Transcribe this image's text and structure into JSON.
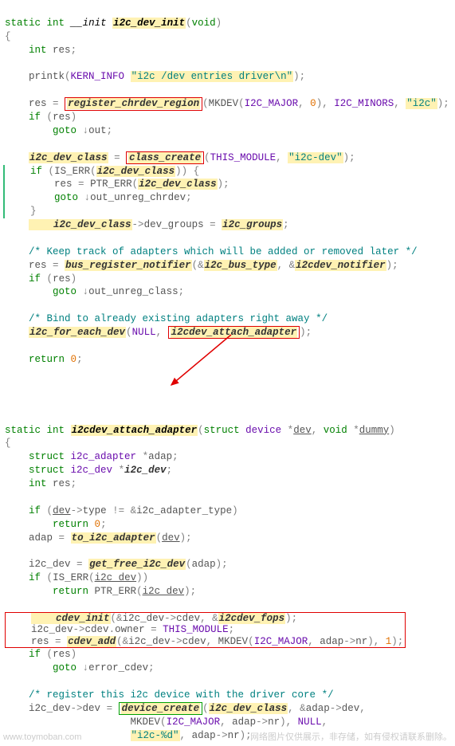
{
  "func1": {
    "sig_pre": "static int __init ",
    "name": "i2c_dev_init",
    "sig_post": "(void)",
    "l01": "    int res;",
    "l02a": "    printk(KERN_INFO ",
    "l02b": "\"i2c /dev entries driver\\n\"",
    "l02c": ");",
    "l03a": "    res = ",
    "l03b": "register_chrdev_region",
    "l03c": "(MKDEV(I2C_MAJOR, 0), I2C_MINORS, ",
    "l03d": "\"i2c\"",
    "l03e": ");",
    "l04": "    if (res)",
    "l05": "        goto ↓out;",
    "l06a": "    i2c_dev_class = ",
    "l06b": "class_create",
    "l06c": "(THIS_MODULE, ",
    "l06d": "\"i2c-dev\"",
    "l06e": ");",
    "l07a": "    if (IS_ERR(",
    "l07b": "i2c_dev_class",
    "l07c": ")) {",
    "l08a": "        res = PTR_ERR(",
    "l08b": "i2c_dev_class",
    "l08c": ");",
    "l09": "        goto ↓out_unreg_chrdev;",
    "l10": "    }",
    "l11a": "    i2c_dev_class",
    "l11b": "->dev_groups = ",
    "l11c": "i2c_groups",
    "l11d": ";",
    "l12": "    /* Keep track of adapters which will be added or removed later */",
    "l13a": "    res = ",
    "l13b": "bus_register_notifier",
    "l13c": "(&",
    "l13d": "i2c_bus_type",
    "l13e": ", &",
    "l13f": "i2cdev_notifier",
    "l13g": ");",
    "l14": "    if (res)",
    "l15": "        goto ↓out_unreg_class;",
    "l16": "    /* Bind to already existing adapters right away */",
    "l17a": "    i2c_for_each_dev",
    "l17b": "(NULL, ",
    "l17c": "i2cdev_attach_adapter",
    "l17d": ");",
    "l18": "    return 0;"
  },
  "func2": {
    "sig_pre": "static int ",
    "name": "i2cdev_attach_adapter",
    "sig_post_a": "(struct device *",
    "sig_post_b": "dev",
    "sig_post_c": ", void *",
    "sig_post_d": "dummy",
    "sig_post_e": ")",
    "l01": "    struct i2c_adapter *adap;",
    "l02a": "    struct i2c_dev *",
    "l02b": "i2c_dev",
    "l02c": ";",
    "l03": "    int res;",
    "l04a": "    if (",
    "l04b": "dev",
    "l04c": "->type != &i2c_adapter_type)",
    "l05": "        return 0;",
    "l06a": "    adap = ",
    "l06b": "to_i2c_adapter",
    "l06c": "(",
    "l06d": "dev",
    "l06e": ");",
    "l07a": "    i2c_dev = ",
    "l07b": "get_free_i2c_dev",
    "l07c": "(adap);",
    "l08a": "    if (IS_ERR(",
    "l08b": "i2c_dev",
    "l08c": "))",
    "l09a": "        return PTR_ERR(",
    "l09b": "i2c_dev",
    "l09c": ");",
    "l10a": "    cdev_init",
    "l10b": "(&i2c_dev->cdev, &",
    "l10c": "i2cdev_fops",
    "l10d": ");",
    "l11": "    i2c_dev->cdev.owner = THIS_MODULE;",
    "l12a": "    res = ",
    "l12b": "cdev_add",
    "l12c": "(&i2c_dev->cdev, MKDEV(I2C_MAJOR, adap->nr), 1);",
    "l13": "    if (res)",
    "l14": "        goto ↓error_cdev;",
    "l15": "    /* register this i2c device with the driver core */",
    "l16a": "    i2c_dev->dev = ",
    "l16b": "device_create",
    "l16c": "(",
    "l16d": "i2c_dev_class",
    "l16e": ", &adap->dev,",
    "l17": "                     MKDEV(I2C_MAJOR, adap->nr), NULL,",
    "l18a": "                     ",
    "l18b": "\"i2c-%d\"",
    "l18c": ", adap->nr);"
  },
  "watermark": {
    "left": "www.toymoban.com",
    "right": "网络图片仅供展示，非存储，如有侵权请联系删除。"
  }
}
